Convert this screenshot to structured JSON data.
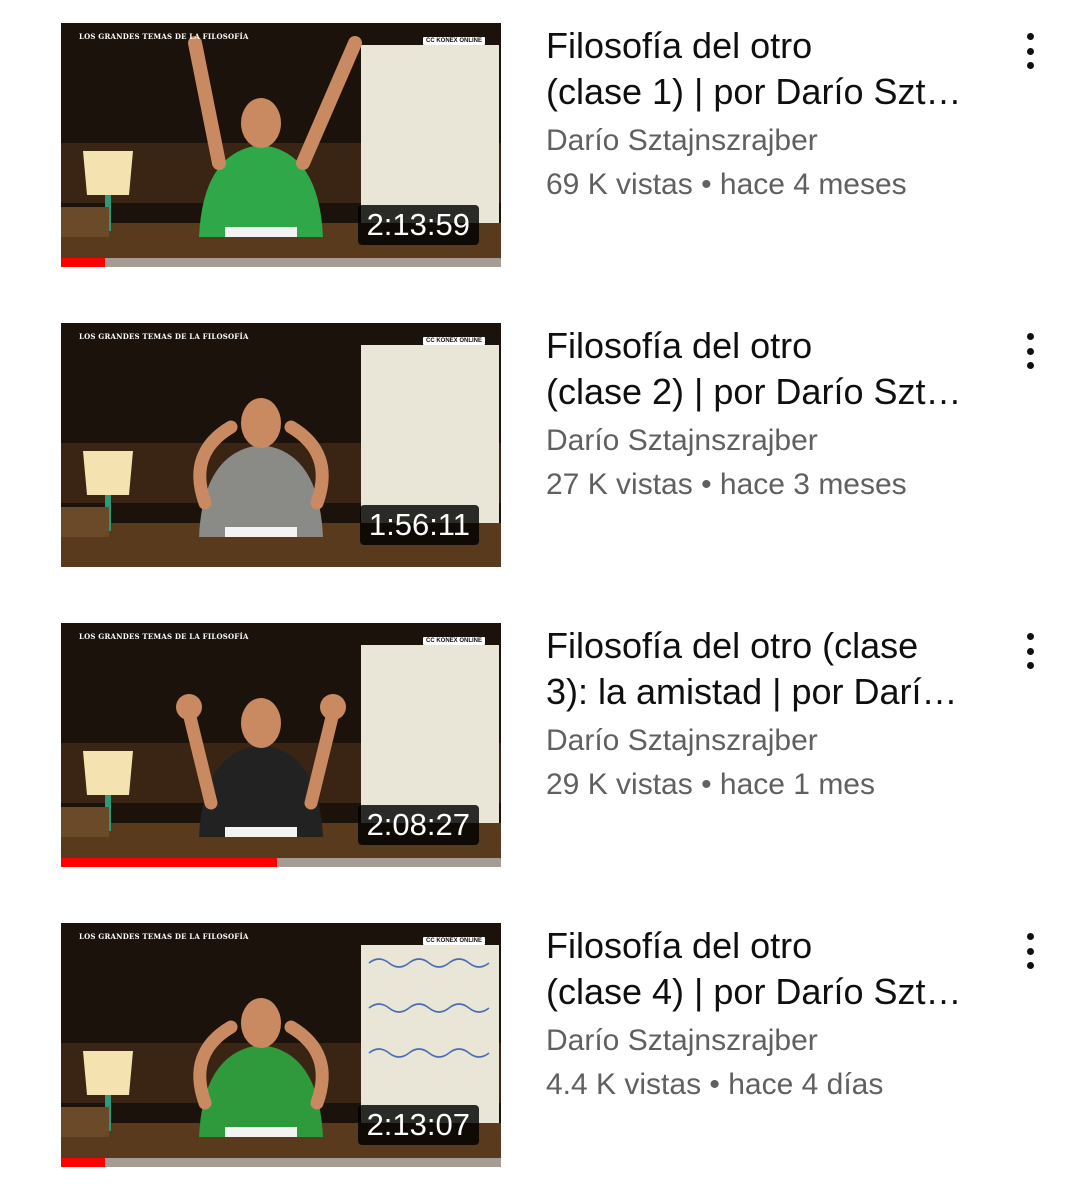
{
  "videos": [
    {
      "title_line1": "Filosofía del otro",
      "title_line2": "(clase 1) | por Darío Szt…",
      "channel": "Darío Sztajnszrajber",
      "meta": "69 K vistas • hace 4 meses",
      "duration": "2:13:59",
      "progress": 0.1,
      "shirt_color": "#2fa84a",
      "pose": "arms-up",
      "board": "blank"
    },
    {
      "title_line1": "Filosofía del otro",
      "title_line2": "(clase 2) | por Darío Szt…",
      "channel": "Darío Sztajnszrajber",
      "meta": "27 K vistas • hace 3 meses",
      "duration": "1:56:11",
      "progress": 0,
      "shirt_color": "#8a8a86",
      "pose": "hands-head",
      "board": "blank"
    },
    {
      "title_line1": "Filosofía del otro (clase",
      "title_line2": "3): la amistad | por Darí…",
      "channel": "Darío Sztajnszrajber",
      "meta": "29 K vistas • hace 1 mes",
      "duration": "2:08:27",
      "progress": 0.49,
      "shirt_color": "#222222",
      "pose": "hands-open",
      "board": "blank"
    },
    {
      "title_line1": "Filosofía del otro",
      "title_line2": "(clase 4) | por Darío Szt…",
      "channel": "Darío Sztajnszrajber",
      "meta": "4.4 K vistas • hace 4 días",
      "duration": "2:13:07",
      "progress": 0.1,
      "shirt_color": "#2f9a3c",
      "pose": "hands-head",
      "board": "written"
    }
  ],
  "thumb_logo": "LOS GRANDES TEMAS DE LA FILOSOFÍA",
  "thumb_brand": "CC KONEX ONLINE",
  "menu_icon": "more-vert-icon",
  "colors": {
    "progress": "#ff0000",
    "title": "#0f0f0f",
    "secondary": "#606060"
  }
}
